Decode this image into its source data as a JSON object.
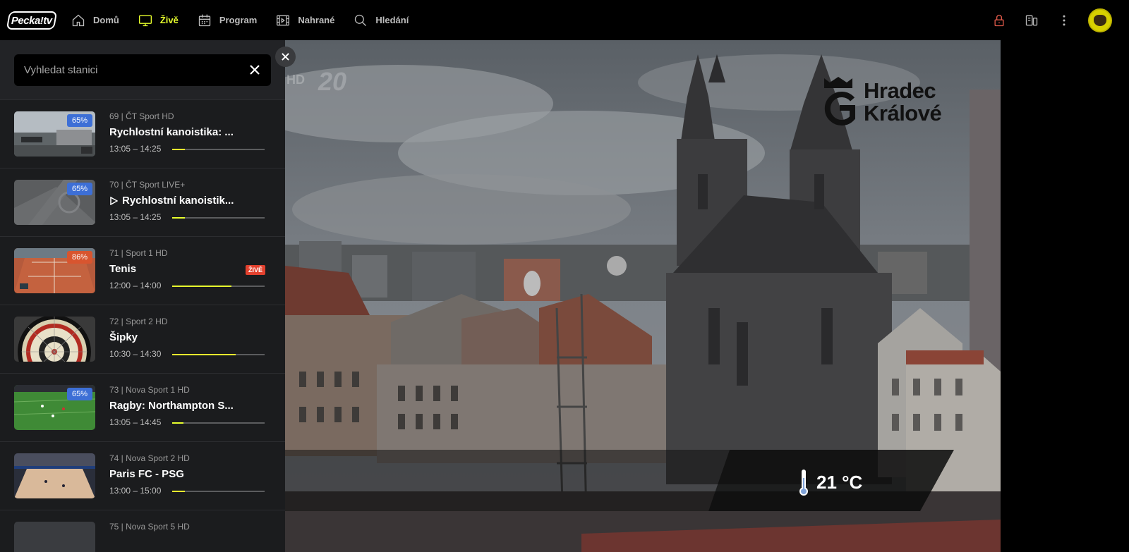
{
  "app": {
    "logo_text": "Pecka!tv"
  },
  "nav": [
    {
      "label": "Domů",
      "icon": "home-icon",
      "active": false
    },
    {
      "label": "Živě",
      "icon": "tv-icon",
      "active": true
    },
    {
      "label": "Program",
      "icon": "calendar-icon",
      "active": false
    },
    {
      "label": "Nahrané",
      "icon": "recordings-icon",
      "active": false
    },
    {
      "label": "Hledání",
      "icon": "search-icon",
      "active": false
    }
  ],
  "top_right": {
    "lock_icon": "lock-icon",
    "devices_icon": "devices-icon",
    "menu_icon": "more-vertical-icon",
    "avatar": "bison-avatar"
  },
  "search": {
    "placeholder": "Vyhledat stanici",
    "value": ""
  },
  "channels": [
    {
      "meta": "69 | ČT Sport HD",
      "title": "Rychlostní kanoistika: ...",
      "time": "13:05 – 14:25",
      "percent": "65%",
      "progress": 0.14,
      "playing": false,
      "live": ""
    },
    {
      "meta": "70 | ČT Sport LIVE+",
      "title": "Rychlostní kanoistik...",
      "time": "13:05 – 14:25",
      "percent": "65%",
      "progress": 0.14,
      "playing": true,
      "live": ""
    },
    {
      "meta": "71 | Sport 1 HD",
      "title": "Tenis",
      "time": "12:00 – 14:00",
      "percent": "86%",
      "progress": 0.64,
      "playing": false,
      "live": "ŽIVĚ"
    },
    {
      "meta": "72 | Sport 2 HD",
      "title": "Šipky",
      "time": "10:30 – 14:30",
      "percent": "",
      "progress": 0.69,
      "playing": false,
      "live": ""
    },
    {
      "meta": "73 | Nova Sport 1 HD",
      "title": "Ragby: Northampton S...",
      "time": "13:05 – 14:45",
      "percent": "65%",
      "progress": 0.12,
      "playing": false,
      "live": ""
    },
    {
      "meta": "74 | Nova Sport 2 HD",
      "title": "Paris FC - PSG",
      "time": "13:00 – 15:00",
      "percent": "",
      "progress": 0.14,
      "playing": false,
      "live": ""
    },
    {
      "meta": "75 | Nova Sport 5 HD",
      "title": "",
      "time": "",
      "percent": "",
      "progress": 0,
      "playing": false,
      "live": ""
    }
  ],
  "video": {
    "watermark_hd": "HD",
    "watermark_20": "20",
    "brand_line1": "Hradec",
    "brand_line2": "Králové",
    "temperature": "21 °C"
  },
  "colors": {
    "accent": "#e8ff2d",
    "live": "#e3412e",
    "percent_blue": "#3d6fd6",
    "percent_orange": "#d8552f"
  }
}
